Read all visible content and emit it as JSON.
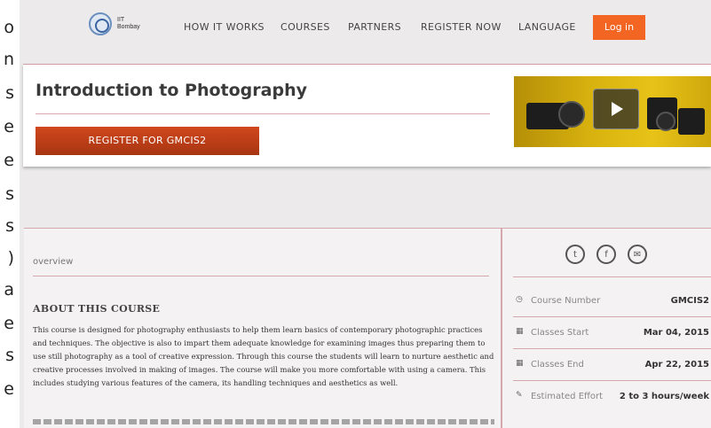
{
  "left_fragments": [
    "o",
    "n",
    "s",
    "e",
    "e",
    "s",
    "s",
    ")",
    "a",
    "e",
    "s",
    "e"
  ],
  "nav": {
    "logo_text_line1": "IIT",
    "logo_text_line2": "Bombay",
    "links": [
      "HOW IT WORKS",
      "COURSES",
      "PARTNERS",
      "REGISTER NOW",
      "LANGUAGE"
    ],
    "login": "Log in"
  },
  "header": {
    "title": "Introduction to Photography",
    "register_button": "REGISTER FOR GMCIS2",
    "video_icon": "play-icon"
  },
  "main": {
    "tab": "overview",
    "about_heading": "ABOUT THIS COURSE",
    "about_text": "This course is designed for photography enthusiasts to help them learn basics of contemporary photographic practices and techniques. The objective is also to impart them adequate knowledge for examining images thus preparing them to use still photography as a tool of creative expression. Through this course the students will learn to nurture aesthetic and creative processes involved in making of images. The course will make you more comfortable with using a camera. This includes studying various features of the camera, its handling techniques and aesthetics as well."
  },
  "sidebar": {
    "share_icons": [
      "twitter-icon",
      "facebook-icon",
      "email-icon"
    ],
    "info": [
      {
        "icon": "clock-icon",
        "label": "Course Number",
        "value": "GMCIS2"
      },
      {
        "icon": "calendar-icon",
        "label": "Classes Start",
        "value": "Mar 04, 2015"
      },
      {
        "icon": "calendar-icon",
        "label": "Classes End",
        "value": "Apr 22, 2015"
      },
      {
        "icon": "pencil-icon",
        "label": "Estimated Effort",
        "value": "2 to 3 hours/week"
      }
    ]
  },
  "colors": {
    "accent": "#f26522",
    "register": "#c2401a",
    "rule": "#d5a8b0"
  }
}
